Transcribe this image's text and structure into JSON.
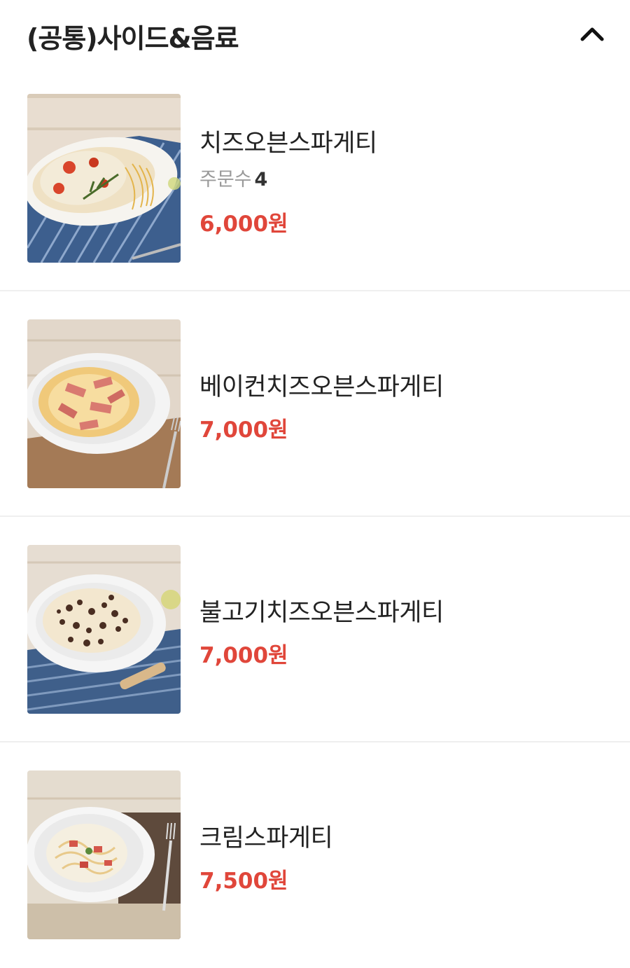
{
  "section": {
    "title": "(공통)사이드&음료",
    "toggle_icon": "chevron-up-icon"
  },
  "items": [
    {
      "name": "치즈오븐스파게티",
      "orders_label": "주문수",
      "orders_count": "4",
      "price": "6,000원",
      "image": "cheese-oven-spaghetti-photo"
    },
    {
      "name": "베이컨치즈오븐스파게티",
      "price": "7,000원",
      "image": "bacon-cheese-oven-spaghetti-photo"
    },
    {
      "name": "불고기치즈오븐스파게티",
      "price": "7,000원",
      "image": "bulgogi-cheese-oven-spaghetti-photo"
    },
    {
      "name": "크림스파게티",
      "price": "7,500원",
      "image": "cream-spaghetti-photo"
    }
  ],
  "colors": {
    "price": "#e0463a",
    "title": "#222222",
    "muted": "#9a9a9a",
    "divider": "#efefef"
  }
}
